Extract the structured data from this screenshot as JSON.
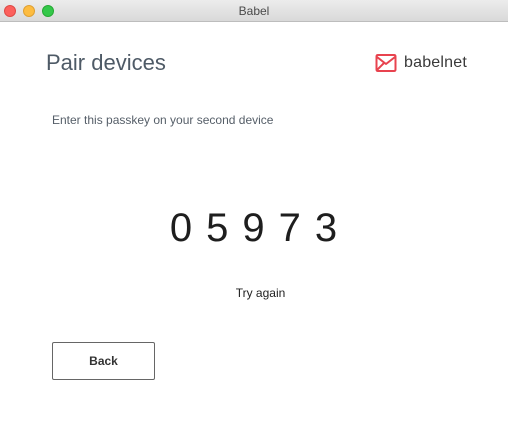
{
  "window": {
    "title": "Babel"
  },
  "header": {
    "title": "Pair devices",
    "brand_name": "babelnet",
    "brand_icon": "envelope-icon",
    "brand_color": "#e8434f"
  },
  "main": {
    "instruction": "Enter this passkey on your second device",
    "passkey": "05973",
    "try_again_label": "Try again",
    "back_label": "Back"
  },
  "colors": {
    "close": "#fc605c",
    "minimize": "#fdbc40",
    "maximize": "#34c84a"
  }
}
